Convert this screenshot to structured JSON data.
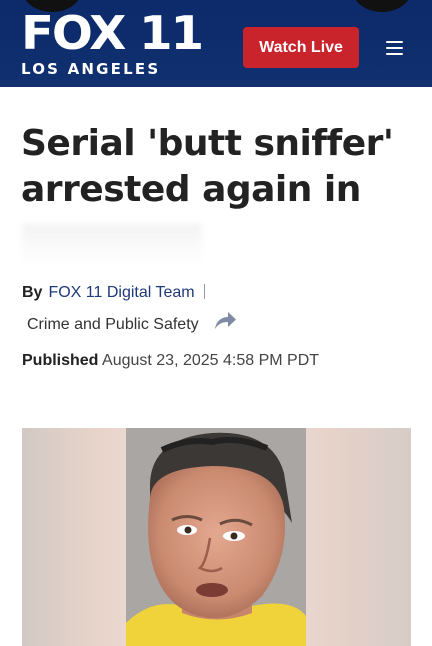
{
  "header": {
    "logo_main": "FOX 11",
    "logo_sub": "LOS ANGELES",
    "watch_live_label": "Watch Live",
    "menu_icon": "hamburger-menu-icon"
  },
  "article": {
    "headline": "Serial 'butt sniffer' arrested again in",
    "byline_prefix": "By",
    "author": "FOX 11 Digital Team",
    "category": "Crime and Public Safety",
    "share_icon": "share-arrow-icon",
    "published_label": "Published",
    "published_date": "August 23, 2025 4:58 PM PDT"
  },
  "colors": {
    "header_bg": "#0d2a6b",
    "watch_live_bg": "#c9232b",
    "author_link": "#1d3a78",
    "headline_text": "#222222"
  }
}
